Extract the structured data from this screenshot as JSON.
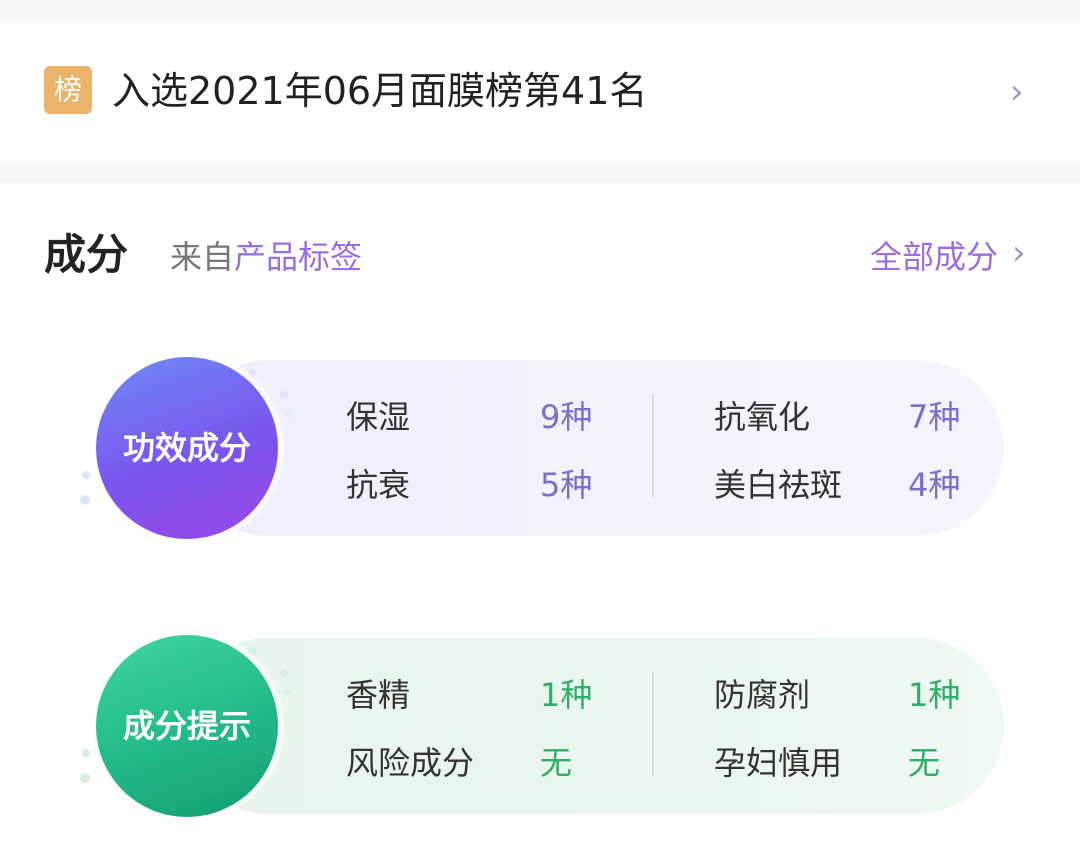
{
  "rank": {
    "badge": "榜",
    "text": "入选2021年06月面膜榜第41名",
    "chevron": "›"
  },
  "ingredients": {
    "title": "成分",
    "source_prefix": "来自",
    "source_link": "产品标签",
    "all_link": "全部成分",
    "all_chevron": "›"
  },
  "efficacy": {
    "circle_label": "功效成分",
    "items": [
      {
        "label": "保湿",
        "value": "9种"
      },
      {
        "label": "抗氧化",
        "value": "7种"
      },
      {
        "label": "抗衰",
        "value": "5种"
      },
      {
        "label": "美白祛斑",
        "value": "4种"
      }
    ]
  },
  "tips": {
    "circle_label": "成分提示",
    "items": [
      {
        "label": "香精",
        "value": "1种"
      },
      {
        "label": "防腐剂",
        "value": "1种"
      },
      {
        "label": "风险成分",
        "value": "无"
      },
      {
        "label": "孕妇慎用",
        "value": "无"
      }
    ]
  },
  "colors": {
    "accent_purple": "#9a6ee0",
    "value_purple": "#7b6fc9",
    "value_green": "#2fae6a",
    "badge_orange": "#e9b36a"
  }
}
